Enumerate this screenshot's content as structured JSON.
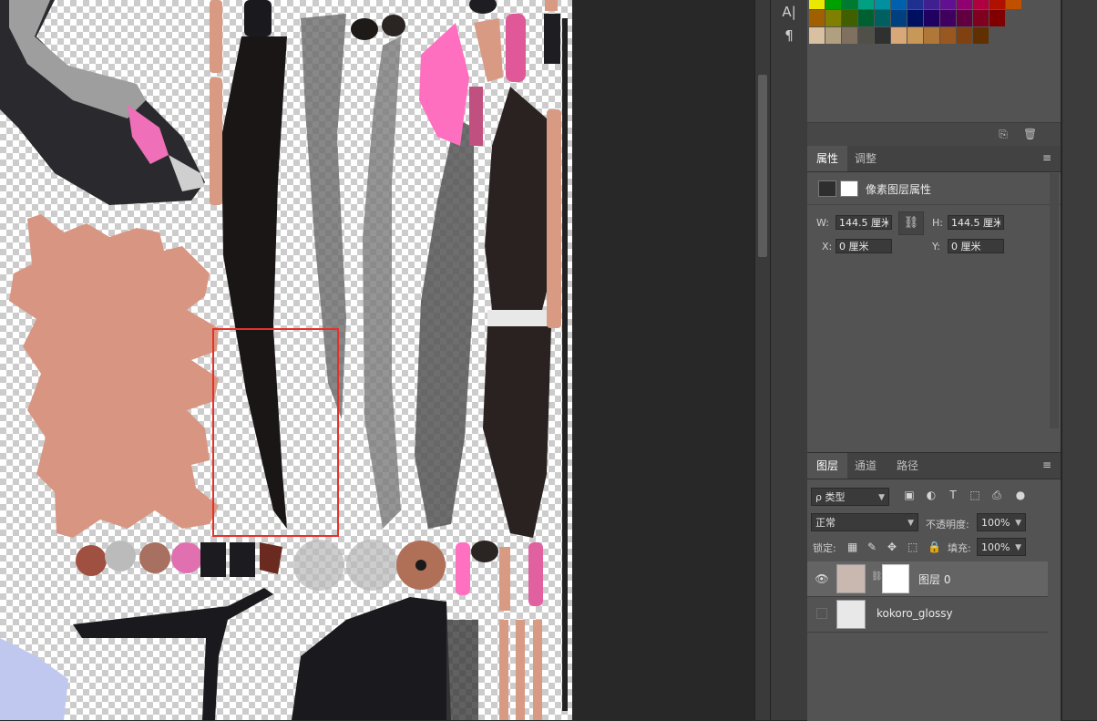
{
  "swatches": {
    "rows": [
      [
        "#e8e800",
        "#00a000",
        "#007a30",
        "#00a080",
        "#0090a0",
        "#0060b0",
        "#203090",
        "#402090",
        "#601090",
        "#900070",
        "#b00040",
        "#b01000",
        "#c05000"
      ],
      [
        "#a06000",
        "#808000",
        "#406000",
        "#006030",
        "#006060",
        "#004080",
        "#001060",
        "#200060",
        "#400060",
        "#600040",
        "#800020",
        "#800000"
      ],
      [
        "#d8c0a0",
        "#b0a080",
        "#807060",
        "#505048",
        "#303030",
        "#d8a878",
        "#c89858",
        "#b07838",
        "#985820",
        "#804010",
        "#603000"
      ]
    ],
    "new_icon": "new-swatch-icon",
    "delete_icon": "trash-icon"
  },
  "properties": {
    "tabs": [
      {
        "label": "属性"
      },
      {
        "label": "调整"
      }
    ],
    "header": "像素图层属性",
    "w_label": "W:",
    "w_value": "144.5 厘米",
    "h_label": "H:",
    "h_value": "144.5 厘米",
    "x_label": "X:",
    "x_value": "0 厘米",
    "y_label": "Y:",
    "y_value": "0 厘米",
    "link_icon": "link-icon"
  },
  "layers_panel": {
    "tabs": [
      {
        "label": "图层"
      },
      {
        "label": "通道"
      },
      {
        "label": "路径"
      }
    ],
    "filter_kind": "ρ 类型",
    "blend_mode": "正常",
    "opacity_label": "不透明度:",
    "opacity_value": "100%",
    "lock_label": "锁定:",
    "fill_label": "填充:",
    "fill_value": "100%",
    "layers": [
      {
        "name": "图层 0",
        "selected": true,
        "visible": true
      },
      {
        "name": "kokoro_glossy",
        "selected": false,
        "visible": false
      }
    ]
  },
  "toolstrip": {
    "items": [
      {
        "glyph": "A|"
      },
      {
        "glyph": "¶"
      }
    ]
  },
  "selection": {
    "color": "#e8302a"
  }
}
